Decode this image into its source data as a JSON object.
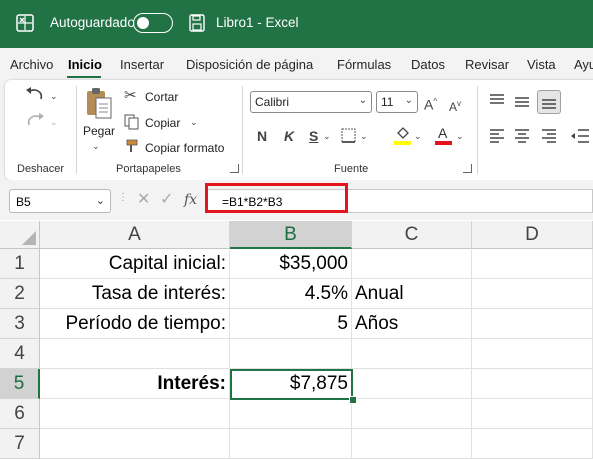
{
  "titlebar": {
    "autosave_label": "Autoguardado",
    "title": "Libro1  -  Excel"
  },
  "menu": {
    "tabs": [
      "Archivo",
      "Inicio",
      "Insertar",
      "Disposición de página",
      "Fórmulas",
      "Datos",
      "Revisar",
      "Vista",
      "Ayu"
    ],
    "active": "Inicio"
  },
  "ribbon": {
    "undo_group": "Deshacer",
    "clipboard": {
      "paste": "Pegar",
      "cut": "Cortar",
      "copy": "Copiar",
      "format_painter": "Copiar formato",
      "group": "Portapapeles"
    },
    "font": {
      "name": "Calibri",
      "size": "11",
      "bold": "N",
      "italic": "K",
      "underline": "S",
      "group": "Fuente",
      "fill_color": "#ffff00",
      "font_color": "#e3141b"
    }
  },
  "formula_bar": {
    "name_box": "B5",
    "fx": "fx",
    "formula": "=B1*B2*B3"
  },
  "grid": {
    "columns": [
      "A",
      "B",
      "C",
      "D"
    ],
    "rows": [
      "1",
      "2",
      "3",
      "4",
      "5",
      "6",
      "7"
    ],
    "selected_column": "B",
    "selected_row": "5",
    "cells": {
      "A1": "Capital inicial:",
      "B1": "$35,000",
      "C1": "",
      "A2": "Tasa de interés:",
      "B2": "4.5%",
      "C2": "Anual",
      "A3": "Período de tiempo:",
      "B3": "5",
      "C3": "Años",
      "A5": "Interés:",
      "B5": "$7,875"
    }
  },
  "colors": {
    "excel_green": "#217346",
    "highlight_red": "#e3141b"
  }
}
